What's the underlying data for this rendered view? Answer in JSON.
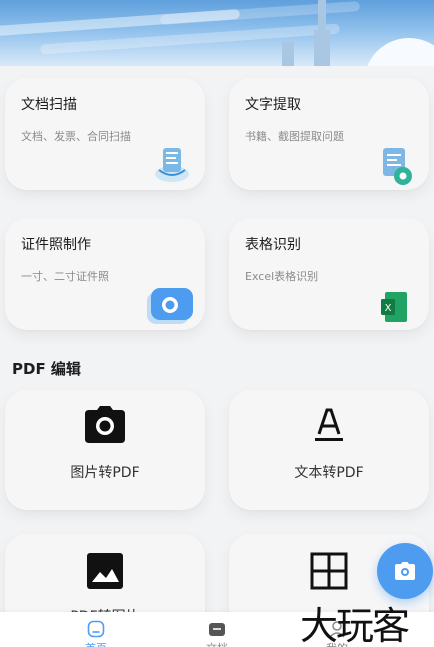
{
  "features": [
    {
      "title": "文档扫描",
      "subtitle": "文档、发票、合同扫描",
      "icon": "scan-document-icon"
    },
    {
      "title": "文字提取",
      "subtitle": "书籍、截图提取问题",
      "icon": "text-extract-icon"
    },
    {
      "title": "证件照制作",
      "subtitle": "一寸、二寸证件照",
      "icon": "camera-icon"
    },
    {
      "title": "表格识别",
      "subtitle": "Excel表格识别",
      "icon": "excel-icon"
    }
  ],
  "pdf_section": {
    "title": "PDF 编辑",
    "items": [
      {
        "label": "图片转PDF",
        "icon": "camera-icon"
      },
      {
        "label": "文本转PDF",
        "icon": "text-icon"
      },
      {
        "label": "PDF转图片",
        "icon": "image-icon"
      },
      {
        "label": "",
        "icon": "grid-icon"
      }
    ]
  },
  "fab": {
    "icon": "camera-icon"
  },
  "nav": [
    {
      "label": "首页",
      "icon": "home-icon",
      "active": true
    },
    {
      "label": "文档",
      "icon": "folder-icon",
      "active": false
    },
    {
      "label": "我的",
      "icon": "user-icon",
      "active": false
    }
  ],
  "watermark": "大玩客",
  "colors": {
    "accent": "#4e9cf0",
    "background": "#f2f3f5",
    "card": "#f6f6f7"
  }
}
